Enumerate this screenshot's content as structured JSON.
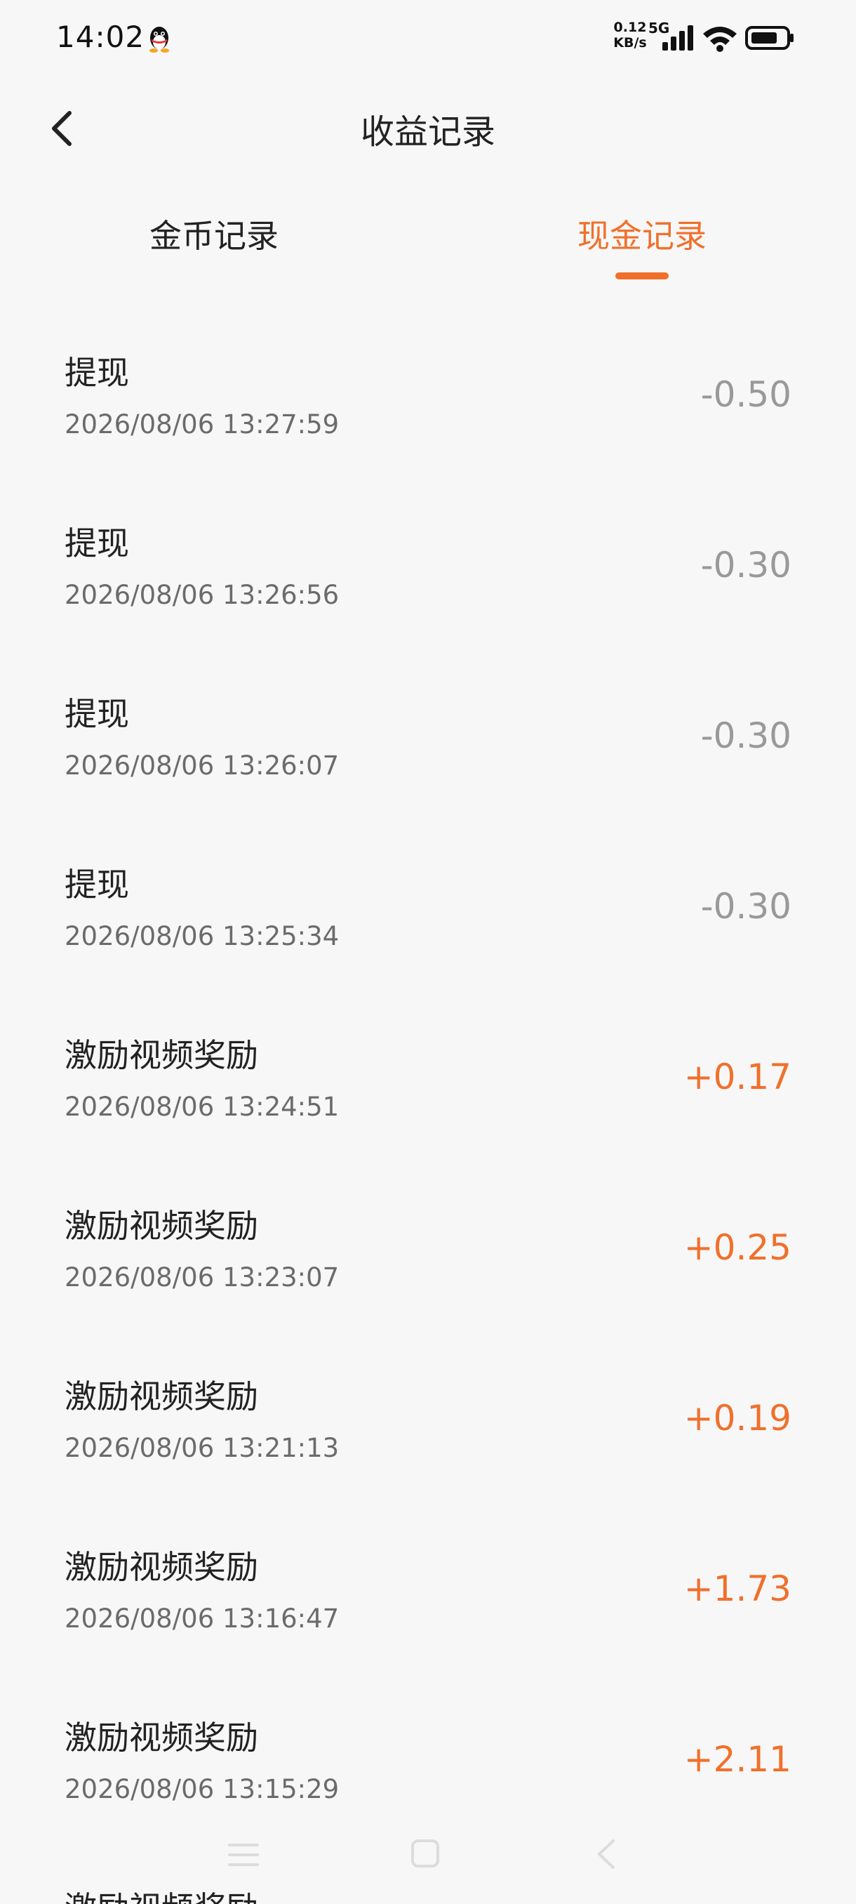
{
  "status_bar": {
    "time": "14:02",
    "net_speed_value": "0.12",
    "net_speed_unit": "KB/s",
    "network": "5G",
    "signal_icon": "signal-icon",
    "wifi_icon": "wifi-icon",
    "battery_icon": "battery-icon",
    "notification_icon": "qq-penguin-icon"
  },
  "header": {
    "back_icon": "chevron-left-icon",
    "title": "收益记录"
  },
  "tabs": [
    {
      "label": "金币记录",
      "active": false
    },
    {
      "label": "现金记录",
      "active": true
    }
  ],
  "colors": {
    "accent": "#f0702b",
    "negative_amount": "#999999",
    "background": "#f7f7f7"
  },
  "records": [
    {
      "name": "提现",
      "time": "2026/08/06 13:27:59",
      "amount": "-0.50",
      "positive": false
    },
    {
      "name": "提现",
      "time": "2026/08/06 13:26:56",
      "amount": "-0.30",
      "positive": false
    },
    {
      "name": "提现",
      "time": "2026/08/06 13:26:07",
      "amount": "-0.30",
      "positive": false
    },
    {
      "name": "提现",
      "time": "2026/08/06 13:25:34",
      "amount": "-0.30",
      "positive": false
    },
    {
      "name": "激励视频奖励",
      "time": "2026/08/06 13:24:51",
      "amount": "+0.17",
      "positive": true
    },
    {
      "name": "激励视频奖励",
      "time": "2026/08/06 13:23:07",
      "amount": "+0.25",
      "positive": true
    },
    {
      "name": "激励视频奖励",
      "time": "2026/08/06 13:21:13",
      "amount": "+0.19",
      "positive": true
    },
    {
      "name": "激励视频奖励",
      "time": "2026/08/06 13:16:47",
      "amount": "+1.73",
      "positive": true
    },
    {
      "name": "激励视频奖励",
      "time": "2026/08/06 13:15:29",
      "amount": "+2.11",
      "positive": true
    },
    {
      "name": "激励视频奖励",
      "time": "",
      "amount": "",
      "positive": true
    }
  ],
  "system_nav": {
    "menu_icon": "menu-icon",
    "home_icon": "home-icon",
    "back_icon": "back-icon"
  }
}
